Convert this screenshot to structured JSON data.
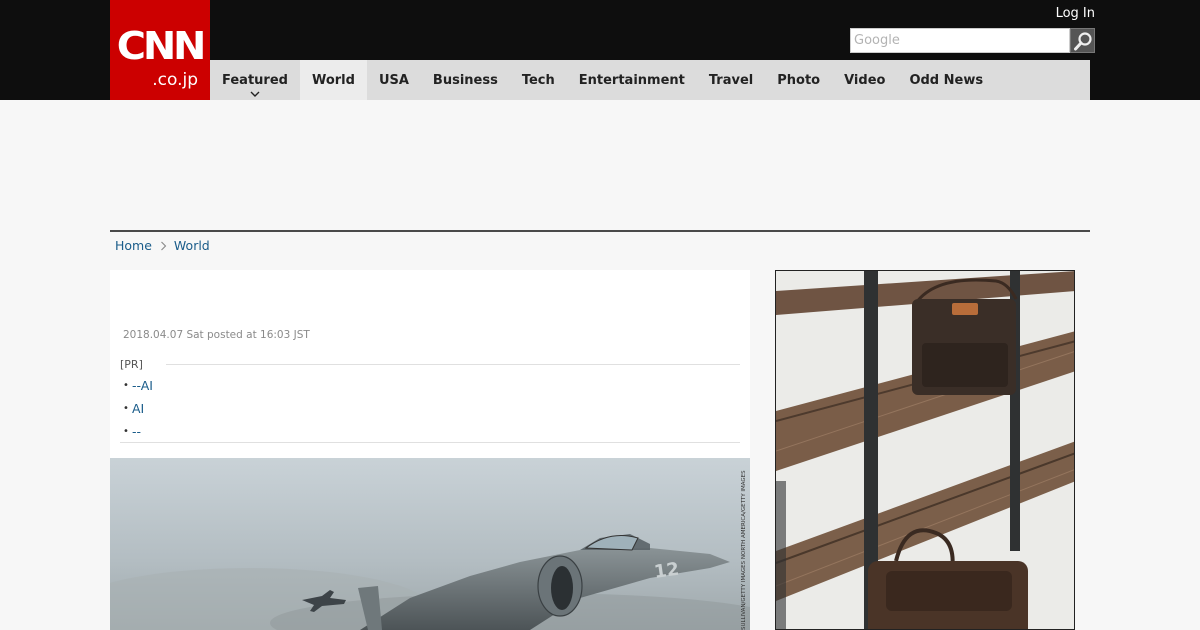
{
  "header": {
    "logo": {
      "brand": "CNN",
      "suffix": ".co.jp",
      "bg_color": "#cc0000"
    },
    "login_label": "Log In",
    "search": {
      "placeholder": "Google",
      "value": ""
    },
    "search_button_icon": "search-icon"
  },
  "nav": {
    "items": [
      {
        "label": "Featured",
        "has_dropdown": true
      },
      {
        "label": "World",
        "active": true
      },
      {
        "label": "USA"
      },
      {
        "label": "Business"
      },
      {
        "label": "Tech"
      },
      {
        "label": "Entertainment"
      },
      {
        "label": "Travel"
      },
      {
        "label": "Photo"
      },
      {
        "label": "Video"
      },
      {
        "label": "Odd News"
      }
    ]
  },
  "breadcrumb": {
    "home": "Home",
    "current": "World"
  },
  "article": {
    "dateline": "2018.04.07 Sat posted at 16:03 JST",
    "pr": {
      "label": "[PR]",
      "links": [
        "--AI",
        "AI",
        "--"
      ]
    },
    "photo": {
      "description_icon": "fighter-jet-image",
      "credit": "SULLIVAN/GETTY IMAGES NORTH AMERICA/GETTY IMAGES"
    }
  },
  "side_ad": {
    "image": "leather-bags-on-shelf-ad"
  },
  "colors": {
    "topbar": "#0e0e0e",
    "nav_bg": "#dcdcdc",
    "link": "#1a5c8a",
    "brand_red": "#cc0000"
  }
}
